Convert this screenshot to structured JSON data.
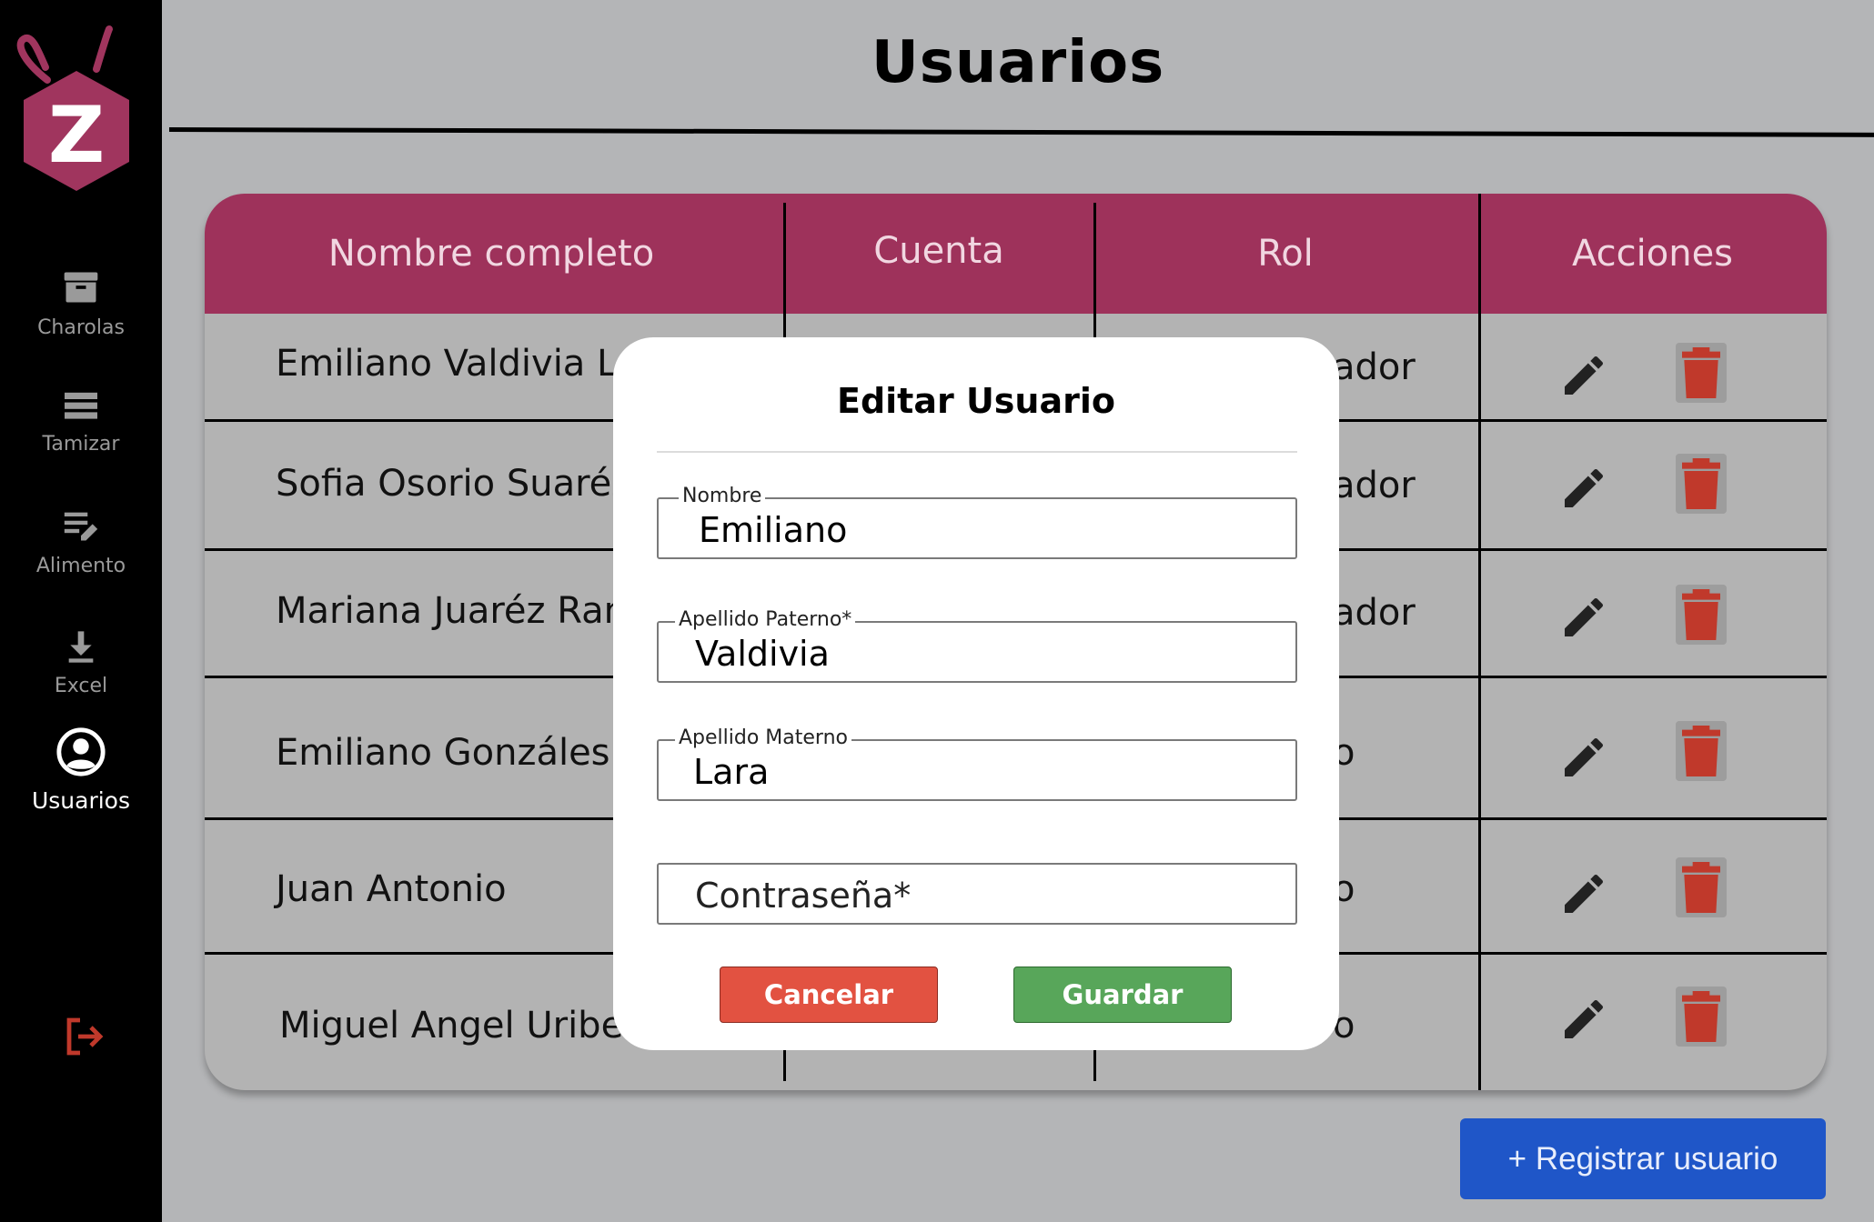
{
  "app": {
    "logo_letter": "Z"
  },
  "sidebar": {
    "items": [
      {
        "label": "Charolas",
        "icon": "archive-icon"
      },
      {
        "label": "Tamizar",
        "icon": "list-icon"
      },
      {
        "label": "Alimento",
        "icon": "edit-note-icon"
      },
      {
        "label": "Excel",
        "icon": "download-icon"
      },
      {
        "label": "Usuarios",
        "icon": "account-circle-icon",
        "active": true
      }
    ],
    "logout_icon": "logout-icon"
  },
  "header": {
    "title": "Usuarios"
  },
  "table": {
    "columns": [
      "Nombre completo",
      "Cuenta",
      "Rol",
      "Acciones"
    ],
    "rows": [
      {
        "name": "Emiliano Valdivia La",
        "rol": "ador"
      },
      {
        "name": "Sofia Osorio Suaréz",
        "rol": "ador"
      },
      {
        "name": "Mariana Juaréz Ran",
        "rol": "ador"
      },
      {
        "name": "Emiliano Gonzáles",
        "rol": "o"
      },
      {
        "name": "Juan Antonio",
        "rol": "o"
      },
      {
        "name": "Miguel Angel Uribe",
        "rol": "o"
      }
    ]
  },
  "register_button": {
    "label": "+ Registrar usuario"
  },
  "modal": {
    "title": "Editar Usuario",
    "fields": [
      {
        "label": "Nombre",
        "value": "Emiliano"
      },
      {
        "label": "Apellido Paterno*",
        "value": "Valdivia"
      },
      {
        "label": "Apellido Materno",
        "value": "Lara"
      },
      {
        "label": "",
        "placeholder": "Contraseña*"
      }
    ],
    "cancel_label": "Cancelar",
    "save_label": "Guardar"
  },
  "colors": {
    "header_bg": "#9e325b",
    "logo": "#a0355e",
    "cancel": "#e25241",
    "save": "#58a65a",
    "register": "#1f56c8",
    "delete_icon": "#c0392b",
    "logout_icon": "#c0392b"
  }
}
